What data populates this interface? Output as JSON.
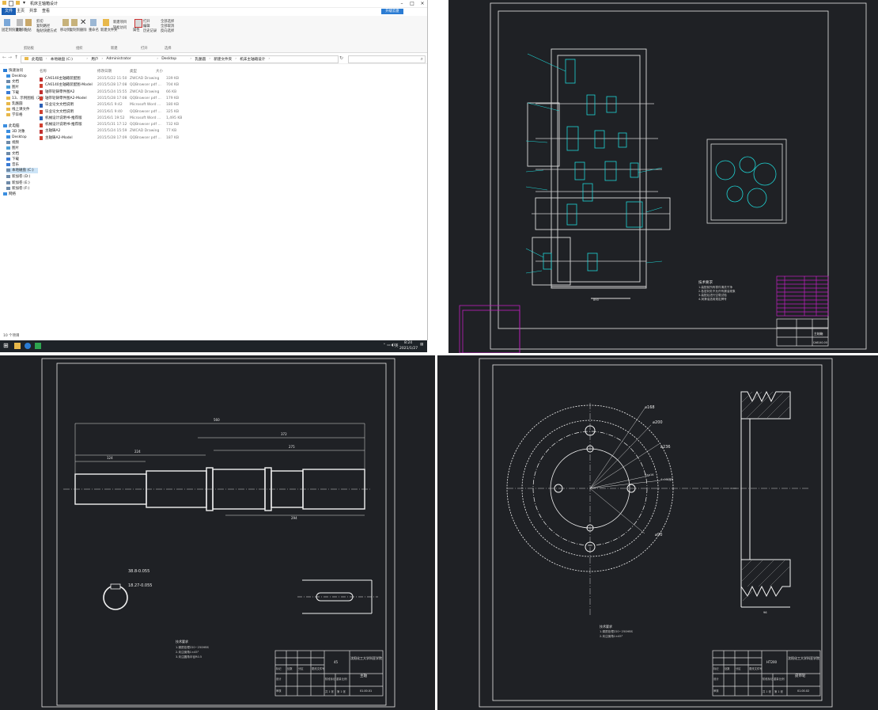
{
  "explorer": {
    "title": "机床主轴箱设计",
    "tabs": [
      "文件",
      "主页",
      "共享",
      "查看"
    ],
    "ribbon": {
      "clipboard": {
        "group": "剪贴板",
        "pin": "固定到快速访问",
        "copy": "复制",
        "paste": "粘贴",
        "copy_path": "复制路径",
        "paste_shortcut": "粘贴快捷方式",
        "cut": "剪切"
      },
      "organize": {
        "group": "组织",
        "move_to": "移动到",
        "copy_to": "复制到",
        "delete": "删除",
        "rename": "重命名"
      },
      "new": {
        "group": "新建",
        "new_folder": "新建文件夹",
        "new_item": "新建项目",
        "easy_access": "轻松访问"
      },
      "open": {
        "group": "打开",
        "properties": "属性",
        "open": "打开",
        "edit": "编辑",
        "history": "历史记录"
      },
      "select": {
        "group": "选择",
        "select_all": "全部选择",
        "select_none": "全部取消",
        "invert": "反向选择"
      },
      "upgrade": "升级云盘"
    },
    "breadcrumb": [
      "此电脑",
      "本地磁盘 (C:)",
      "用户",
      "Administrator",
      "Desktop",
      "乳酪圆",
      "新建文件夹",
      "机床主轴箱设计"
    ],
    "nav": [
      {
        "label": "快速访问",
        "icon": "star-icon",
        "color": "#2b7cd3"
      },
      {
        "label": "Desktop",
        "icon": "desktop-icon",
        "color": "#3b8ee0"
      },
      {
        "label": "文档",
        "icon": "document-icon",
        "color": "#6e8aa8"
      },
      {
        "label": "图片",
        "icon": "pictures-icon",
        "color": "#4a9fd8"
      },
      {
        "label": "下载",
        "icon": "download-icon",
        "color": "#3a7bd5"
      },
      {
        "label": "13、示例图纸（20）",
        "icon": "folder-icon",
        "color": "#e8b84a"
      },
      {
        "label": "乳酪圆",
        "icon": "folder-icon",
        "color": "#e8b84a"
      },
      {
        "label": "线上课文件",
        "icon": "folder-icon",
        "color": "#e8b84a"
      },
      {
        "label": "学毕格",
        "icon": "folder-icon",
        "color": "#e8b84a"
      },
      {
        "label": "此电脑",
        "icon": "computer-icon",
        "color": "#3b8ee0"
      },
      {
        "label": "3D 对象",
        "icon": "cube-icon",
        "color": "#3b8ee0"
      },
      {
        "label": "Desktop",
        "icon": "desktop-icon",
        "color": "#3b8ee0"
      },
      {
        "label": "视频",
        "icon": "video-icon",
        "color": "#6e8aa8"
      },
      {
        "label": "图片",
        "icon": "pictures-icon",
        "color": "#4a9fd8"
      },
      {
        "label": "文档",
        "icon": "document-icon",
        "color": "#6e8aa8"
      },
      {
        "label": "下载",
        "icon": "download-icon",
        "color": "#3a7bd5"
      },
      {
        "label": "音乐",
        "icon": "music-icon",
        "color": "#3a7bd5"
      },
      {
        "label": "本地磁盘 (C:)",
        "icon": "drive-icon",
        "color": "#6e8aa8"
      },
      {
        "label": "新加卷 (D:)",
        "icon": "drive-icon",
        "color": "#6e8aa8"
      },
      {
        "label": "新加卷 (E:)",
        "icon": "drive-icon",
        "color": "#6e8aa8"
      },
      {
        "label": "新加卷 (F:)",
        "icon": "drive-icon",
        "color": "#6e8aa8"
      },
      {
        "label": "网络",
        "icon": "network-icon",
        "color": "#3b8ee0"
      }
    ],
    "columns": {
      "name": "名称",
      "date": "修改日期",
      "type": "类型",
      "size": "大小"
    },
    "files": [
      {
        "name": "CA6140主轴箱装配图",
        "date": "2015/5/22 11:50",
        "type": "ZWCAD Drawing",
        "size": "339 KB",
        "icon": "#c03030"
      },
      {
        "name": "CA6140主轴箱装配图-Model",
        "date": "2015/5/28 17:08",
        "type": "QQBrowser pdf ...",
        "size": "704 KB",
        "icon": "#d04030"
      },
      {
        "name": "轴带轮铸零件图A2",
        "date": "2015/5/24 15:55",
        "type": "ZWCAD Drawing",
        "size": "66 KB",
        "icon": "#c03030"
      },
      {
        "name": "轴带轮铸零件图A2-Model",
        "date": "2015/5/28 17:08",
        "type": "QQBrowser pdf ...",
        "size": "179 KB",
        "icon": "#d04030"
      },
      {
        "name": "毕业论文文档说明",
        "date": "2015/6/1 9:42",
        "type": "Microsoft Word ...",
        "size": "180 KB",
        "icon": "#2b5fb5"
      },
      {
        "name": "毕业论文文档说明",
        "date": "2015/6/1 9:40",
        "type": "QQBrowser pdf ...",
        "size": "325 KB",
        "icon": "#d04030"
      },
      {
        "name": "机械设计说明书-推荐版",
        "date": "2015/6/1 19:52",
        "type": "Microsoft Word ...",
        "size": "1,495 KB",
        "icon": "#2b5fb5"
      },
      {
        "name": "机械设计说明书-推荐版",
        "date": "2015/5/31 17:12",
        "type": "QQBrowser pdf ...",
        "size": "732 KB",
        "icon": "#d04030"
      },
      {
        "name": "主轴铸A2",
        "date": "2015/5/24 15:59",
        "type": "ZWCAD Drawing",
        "size": "77 KB",
        "icon": "#c03030"
      },
      {
        "name": "主轴铸A2-Model",
        "date": "2015/5/28 17:09",
        "type": "QQBrowser pdf ...",
        "size": "187 KB",
        "icon": "#d04030"
      }
    ],
    "status": "10 个项目"
  },
  "taskbar": {
    "time": "8:24",
    "date": "2021/1/27",
    "lang": "英"
  },
  "drawings": {
    "assembly": {
      "tech_title": "技术要求",
      "tech_notes": [
        "1.装配前所有零件清洗干净",
        "2.各密封处不允许有漏油现象",
        "3.装配后进行空载试验",
        "4.润滑油选用规定牌号"
      ],
      "title_block": "主轴箱",
      "drawing_no": "CA6140-00",
      "dimension": "890"
    },
    "shaft": {
      "overall_dim": "560",
      "dims": [
        "372",
        "275",
        "224",
        "124",
        "294"
      ],
      "section_dims": [
        "38.8-0.055",
        "18.27-0.055"
      ],
      "tech_title": "技术要求",
      "tech_notes": [
        "1.调质处理220~250HBS",
        "2.未注倒角1×45°",
        "3.未注圆角半径R0.5"
      ],
      "org": "沈阳化工大学科亚学院",
      "part_name": "主轴",
      "drawing_no": "01.00.01",
      "table_labels": [
        "标记",
        "处数",
        "分区",
        "更改文件号",
        "签名",
        "年月日",
        "设计",
        "审核",
        "工艺",
        "批准",
        "阶段标记",
        "重量",
        "比例",
        "共 1 张",
        "第 1 张"
      ],
      "material": "45"
    },
    "pulley": {
      "dims": [
        "⌀168",
        "⌀200",
        "⌀236",
        "⌀90",
        "6×⌀16",
        "4×M6深8"
      ],
      "width_dim": "96",
      "tech_title": "技术要求",
      "tech_notes": [
        "1.调质处理220~250HBS",
        "2.未注倒角1×45°"
      ],
      "org": "沈阳化工大学科亚学院",
      "part_name": "皮带轮",
      "drawing_no": "01.00.02",
      "table_labels": [
        "标记",
        "处数",
        "分区",
        "更改文件号",
        "签名",
        "年月日",
        "设计",
        "审核",
        "工艺",
        "批准",
        "阶段标记",
        "重量",
        "比例",
        "共 1 张",
        "第 1 张"
      ],
      "material": "HT200"
    }
  }
}
